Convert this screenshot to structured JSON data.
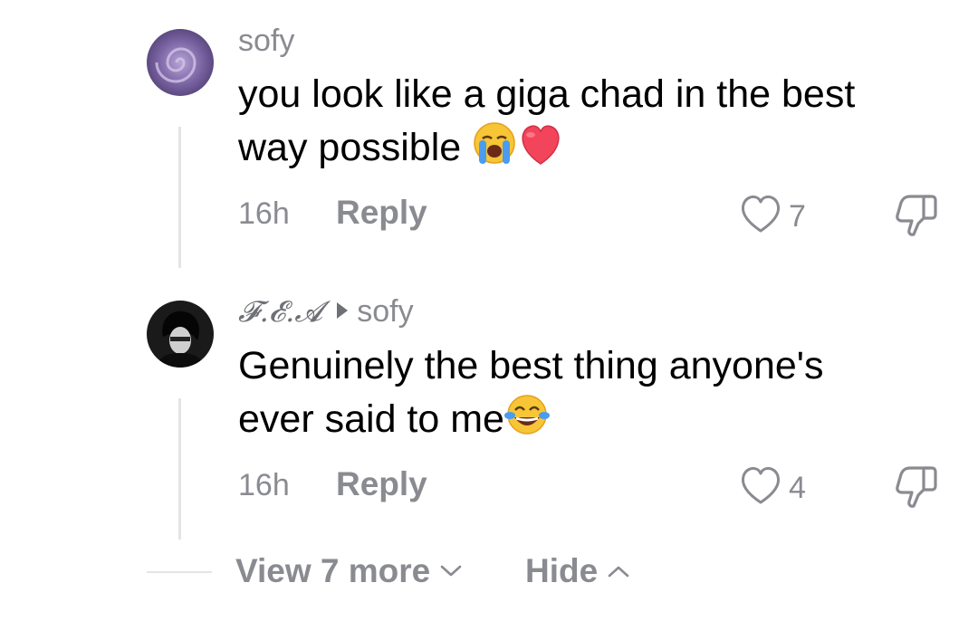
{
  "comments": [
    {
      "username": "sofy",
      "text_line1": "you look like a giga chad in the best",
      "text_line2": "way possible",
      "emojis": [
        "loudly-crying-face",
        "red-heart"
      ],
      "time": "16h",
      "reply_label": "Reply",
      "like_count": "7"
    },
    {
      "username": "𝓕.𝓔.𝓐",
      "reply_to": "sofy",
      "text_line1": "Genuinely the best thing anyone's",
      "text_line2": "ever said to me",
      "emojis": [
        "face-with-tears-of-joy"
      ],
      "time": "16h",
      "reply_label": "Reply",
      "like_count": "4"
    }
  ],
  "footer": {
    "view_more_label": "View 7 more",
    "hide_label": "Hide"
  },
  "colors": {
    "text": "#000000",
    "muted": "#8a8b91",
    "thread_line": "#e4e4e6"
  }
}
